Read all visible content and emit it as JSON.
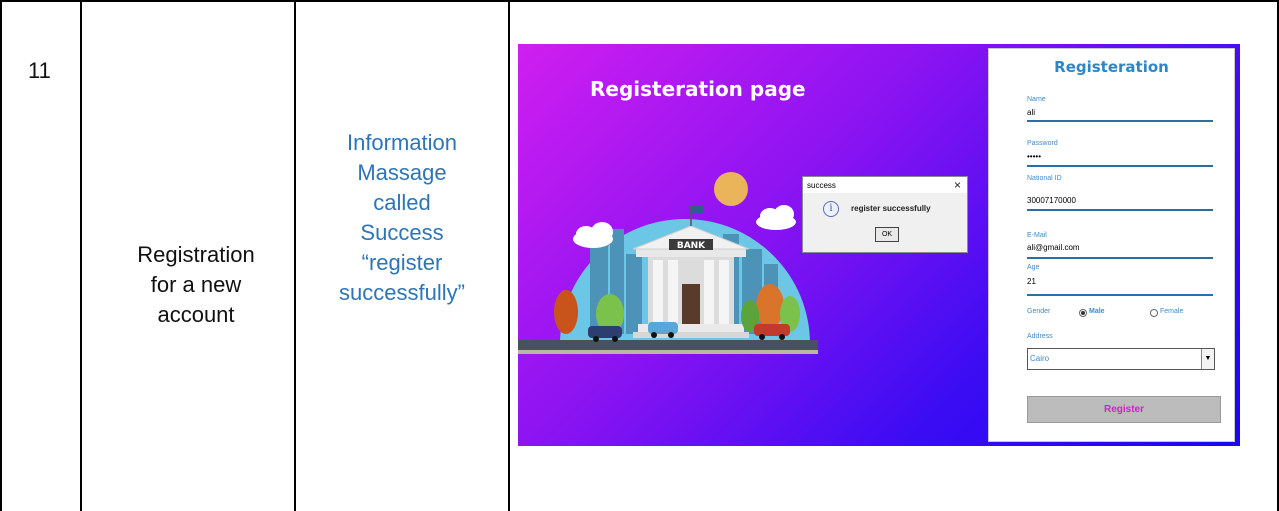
{
  "row": {
    "number": "11",
    "description_lines": [
      "Registration",
      "for a new",
      "account"
    ],
    "expected_lines": [
      "Information",
      "Massage",
      "called",
      "Success",
      "“register",
      "successfully”"
    ]
  },
  "screenshot": {
    "page_heading": "Registeration page",
    "illustration": {
      "building_sign": "BANK"
    },
    "dialog": {
      "title": "success",
      "close_glyph": "×",
      "info_glyph": "i",
      "message": "register successfully",
      "ok_label": "OK"
    },
    "form": {
      "title": "Registeration",
      "fields": [
        {
          "label": "Name",
          "value": "ali"
        },
        {
          "label": "Password",
          "value": "•••••"
        },
        {
          "label": "National ID",
          "value": "30007170000"
        },
        {
          "label": "E-Mail",
          "value": "ali@gmail.com"
        },
        {
          "label": "Age",
          "value": "21"
        }
      ],
      "gender": {
        "label": "Gender",
        "options": [
          "Male",
          "Female"
        ],
        "selected": "Male"
      },
      "address": {
        "label": "Address",
        "selected": "Cairo"
      },
      "submit_label": "Register"
    },
    "colors": {
      "gradient_start": "#d01ef0",
      "gradient_end": "#1a06f2",
      "accent_blue": "#2f86c7",
      "register_text": "#d11fd1"
    }
  }
}
